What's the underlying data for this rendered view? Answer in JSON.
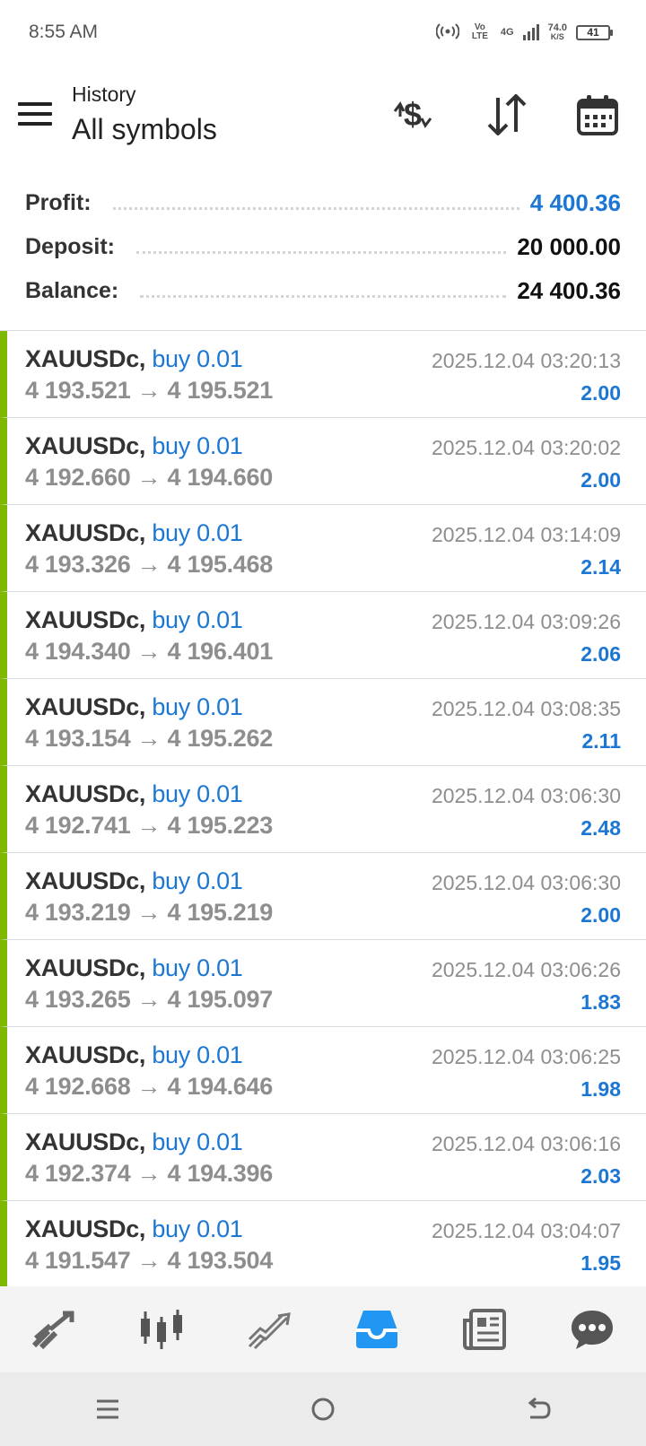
{
  "status_bar": {
    "time": "8:55 AM",
    "net_speed": "74.0",
    "net_unit": "K/S",
    "battery": "41",
    "vo_lte": "Vo LTE",
    "network": "4G"
  },
  "header": {
    "subtitle": "History",
    "title": "All symbols"
  },
  "summary": {
    "profit_label": "Profit:",
    "profit_value": "4 400.36",
    "deposit_label": "Deposit:",
    "deposit_value": "20 000.00",
    "balance_label": "Balance:",
    "balance_value": "24 400.36"
  },
  "trades": [
    {
      "symbol": "XAUUSDc,",
      "type": "buy 0.01",
      "open": "4 193.521",
      "close": "4 195.521",
      "time": "2025.12.04 03:20:13",
      "profit": "2.00"
    },
    {
      "symbol": "XAUUSDc,",
      "type": "buy 0.01",
      "open": "4 192.660",
      "close": "4 194.660",
      "time": "2025.12.04 03:20:02",
      "profit": "2.00"
    },
    {
      "symbol": "XAUUSDc,",
      "type": "buy 0.01",
      "open": "4 193.326",
      "close": "4 195.468",
      "time": "2025.12.04 03:14:09",
      "profit": "2.14"
    },
    {
      "symbol": "XAUUSDc,",
      "type": "buy 0.01",
      "open": "4 194.340",
      "close": "4 196.401",
      "time": "2025.12.04 03:09:26",
      "profit": "2.06"
    },
    {
      "symbol": "XAUUSDc,",
      "type": "buy 0.01",
      "open": "4 193.154",
      "close": "4 195.262",
      "time": "2025.12.04 03:08:35",
      "profit": "2.11"
    },
    {
      "symbol": "XAUUSDc,",
      "type": "buy 0.01",
      "open": "4 192.741",
      "close": "4 195.223",
      "time": "2025.12.04 03:06:30",
      "profit": "2.48"
    },
    {
      "symbol": "XAUUSDc,",
      "type": "buy 0.01",
      "open": "4 193.219",
      "close": "4 195.219",
      "time": "2025.12.04 03:06:30",
      "profit": "2.00"
    },
    {
      "symbol": "XAUUSDc,",
      "type": "buy 0.01",
      "open": "4 193.265",
      "close": "4 195.097",
      "time": "2025.12.04 03:06:26",
      "profit": "1.83"
    },
    {
      "symbol": "XAUUSDc,",
      "type": "buy 0.01",
      "open": "4 192.668",
      "close": "4 194.646",
      "time": "2025.12.04 03:06:25",
      "profit": "1.98"
    },
    {
      "symbol": "XAUUSDc,",
      "type": "buy 0.01",
      "open": "4 192.374",
      "close": "4 194.396",
      "time": "2025.12.04 03:06:16",
      "profit": "2.03"
    },
    {
      "symbol": "XAUUSDc,",
      "type": "buy 0.01",
      "open": "4 191.547",
      "close": "4 193.504",
      "time": "2025.12.04 03:04:07",
      "profit": "1.95"
    }
  ],
  "arrow_glyph": "→",
  "colors": {
    "accent_blue": "#1b77d3",
    "buy_bar_green": "#7fb800",
    "active_tab": "#2196f3"
  },
  "bottom_nav": [
    {
      "name": "quotes-icon",
      "active": false
    },
    {
      "name": "chart-icon",
      "active": false
    },
    {
      "name": "trade-icon",
      "active": false
    },
    {
      "name": "history-icon",
      "active": true
    },
    {
      "name": "news-icon",
      "active": false
    },
    {
      "name": "chat-icon",
      "active": false
    }
  ]
}
